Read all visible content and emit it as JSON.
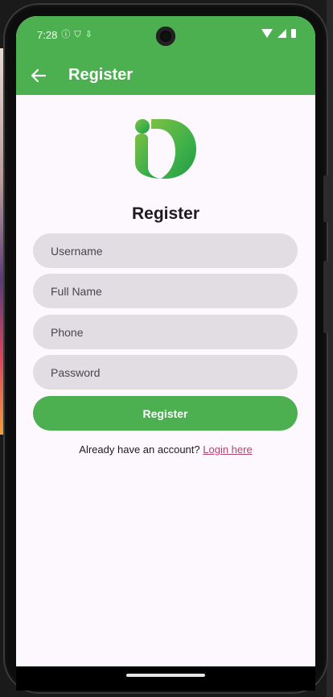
{
  "status": {
    "time": "7:28",
    "icons": [
      "info-icon",
      "shield-icon",
      "download-icon",
      "wifi-icon",
      "signal-icon",
      "battery-icon"
    ]
  },
  "appbar": {
    "title": "Register",
    "back_icon": "arrow-left-icon"
  },
  "form": {
    "heading": "Register",
    "username_placeholder": "Username",
    "fullname_placeholder": "Full Name",
    "phone_placeholder": "Phone",
    "password_placeholder": "Password",
    "submit_label": "Register"
  },
  "footer": {
    "prompt": "Already have an account?",
    "login_link": "Login here"
  },
  "colors": {
    "primary": "#4caf50",
    "background": "#fdf7fe",
    "field_bg": "#e1dde3",
    "link": "#b0456a"
  }
}
